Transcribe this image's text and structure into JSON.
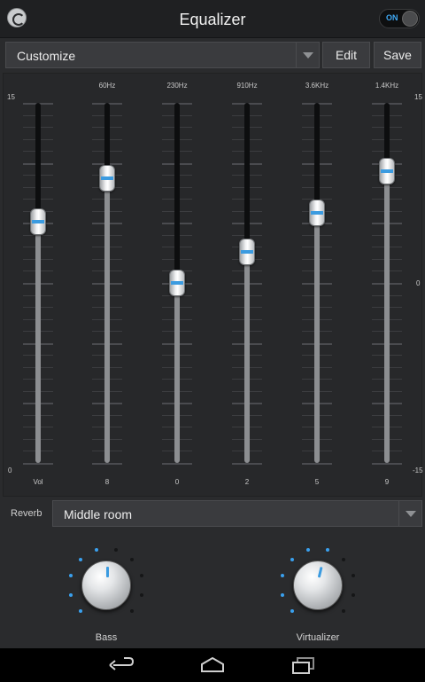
{
  "header": {
    "title": "Equalizer",
    "toggle_label": "ON",
    "toggle_on": true
  },
  "preset": {
    "selected": "Customize",
    "edit_label": "Edit",
    "save_label": "Save"
  },
  "eq": {
    "scale_left_top": "15",
    "scale_left_bottom": "0",
    "scale_right_top": "15",
    "scale_right_mid": "0",
    "scale_right_bottom": "-15",
    "bands": [
      {
        "freq": "",
        "value": "Vol",
        "level": 0.67
      },
      {
        "freq": "60Hz",
        "value": "8",
        "level": 0.79
      },
      {
        "freq": "230Hz",
        "value": "0",
        "level": 0.5
      },
      {
        "freq": "910Hz",
        "value": "2",
        "level": 0.585
      },
      {
        "freq": "3.6KHz",
        "value": "5",
        "level": 0.695
      },
      {
        "freq": "1.4KHz",
        "value": "9",
        "level": 0.81
      }
    ]
  },
  "reverb": {
    "label": "Reverb",
    "selected": "Middle room"
  },
  "effects": {
    "bass": {
      "label": "Bass",
      "level": 0.5
    },
    "virtualizer": {
      "label": "Virtualizer",
      "level": 0.55
    }
  },
  "colors": {
    "accent": "#3b9be0",
    "background": "#2a2b2d"
  }
}
